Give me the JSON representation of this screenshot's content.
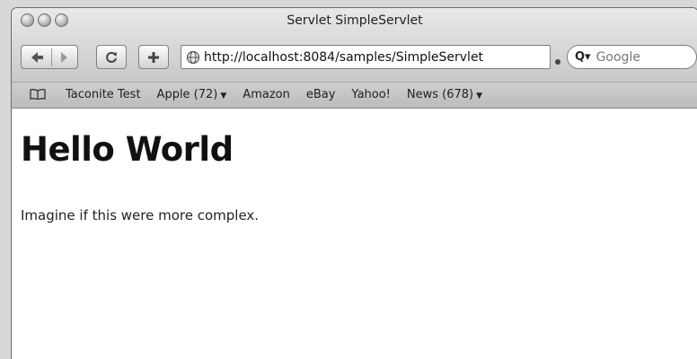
{
  "window": {
    "title": "Servlet SimpleServlet"
  },
  "toolbar": {
    "url": "http://localhost:8084/samples/SimpleServlet",
    "search_placeholder": "Google"
  },
  "bookmarks": [
    {
      "label": "Taconite Test",
      "has_menu": false
    },
    {
      "label": "Apple (72)",
      "has_menu": true
    },
    {
      "label": "Amazon",
      "has_menu": false
    },
    {
      "label": "eBay",
      "has_menu": false
    },
    {
      "label": "Yahoo!",
      "has_menu": false
    },
    {
      "label": "News (678)",
      "has_menu": true
    }
  ],
  "page": {
    "heading": "Hello World",
    "body": "Imagine if this were more complex."
  },
  "icons": {
    "back": "back-arrow-icon",
    "forward": "forward-arrow-icon",
    "reload": "reload-icon",
    "add": "add-bookmark-icon",
    "site": "globe-icon",
    "search": "search-icon",
    "bookmarks": "book-icon"
  }
}
